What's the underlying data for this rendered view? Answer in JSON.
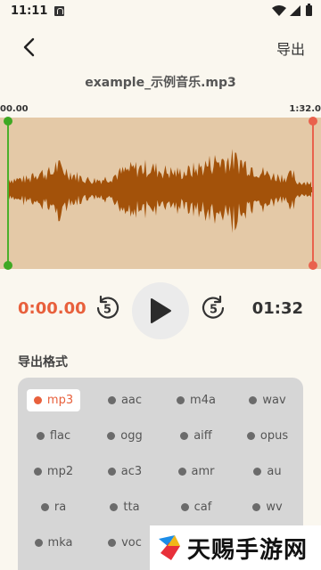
{
  "status_bar": {
    "time": "11:11"
  },
  "header": {
    "back_icon": "chevron-left-icon",
    "export_label": "导出",
    "file_name": "example_示例音乐.mp3"
  },
  "trim": {
    "start_label": "00.00",
    "end_label": "1:32.0",
    "start_handle_color": "#4caf2a",
    "end_handle_color": "#e9624d",
    "waveform_bg": "#e4c9a7",
    "waveform_color": "#a3520a"
  },
  "player": {
    "current_time": "0:00.00",
    "duration": "01:32",
    "rewind_seconds": "5",
    "forward_seconds": "5",
    "accent_color": "#e8603c"
  },
  "export_format": {
    "title": "导出格式",
    "selected": "mp3",
    "options": [
      "mp3",
      "aac",
      "m4a",
      "wav",
      "flac",
      "ogg",
      "aiff",
      "opus",
      "mp2",
      "ac3",
      "amr",
      "au",
      "ra",
      "tta",
      "caf",
      "wv",
      "mka",
      "voc"
    ]
  },
  "watermark": {
    "text": "天赐手游网"
  }
}
